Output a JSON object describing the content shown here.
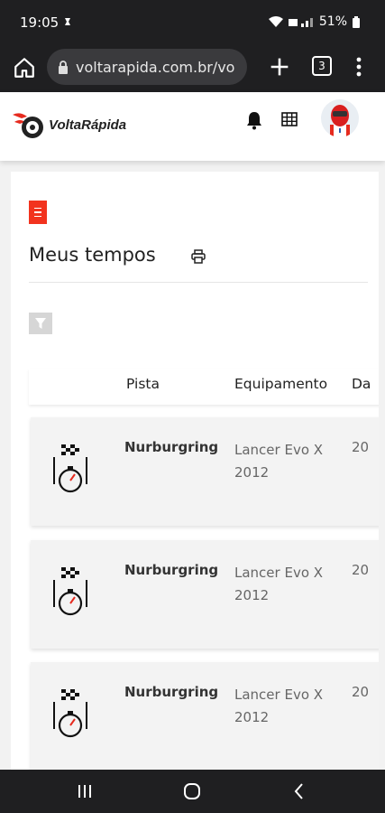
{
  "status": {
    "time": "19:05",
    "battery": "51%"
  },
  "browser": {
    "url": "voltarapida.com.br/vo",
    "tab_count": "3"
  },
  "header": {
    "logo_text": "VoltaRápida"
  },
  "page": {
    "title": "Meus tempos",
    "columns": [
      "Pista",
      "Equipamento",
      "Da"
    ],
    "rows": [
      {
        "track": "Nurburgring",
        "equipment": "Lancer Evo X 2012",
        "date": "20"
      },
      {
        "track": "Nurburgring",
        "equipment": "Lancer Evo X 2012",
        "date": "20"
      },
      {
        "track": "Nurburgring",
        "equipment": "Lancer Evo X 2012",
        "date": "20"
      }
    ]
  },
  "colors": {
    "accent": "#f2331e",
    "dark_bar": "#1f1f21"
  },
  "icons": [
    "home-icon",
    "lock-icon",
    "plus-icon",
    "tabs-icon",
    "more-vert-icon",
    "bell-icon",
    "grid-icon",
    "print-icon",
    "filter-icon",
    "stopwatch-flag-icon",
    "recents-icon",
    "home-circle-icon",
    "back-icon"
  ]
}
